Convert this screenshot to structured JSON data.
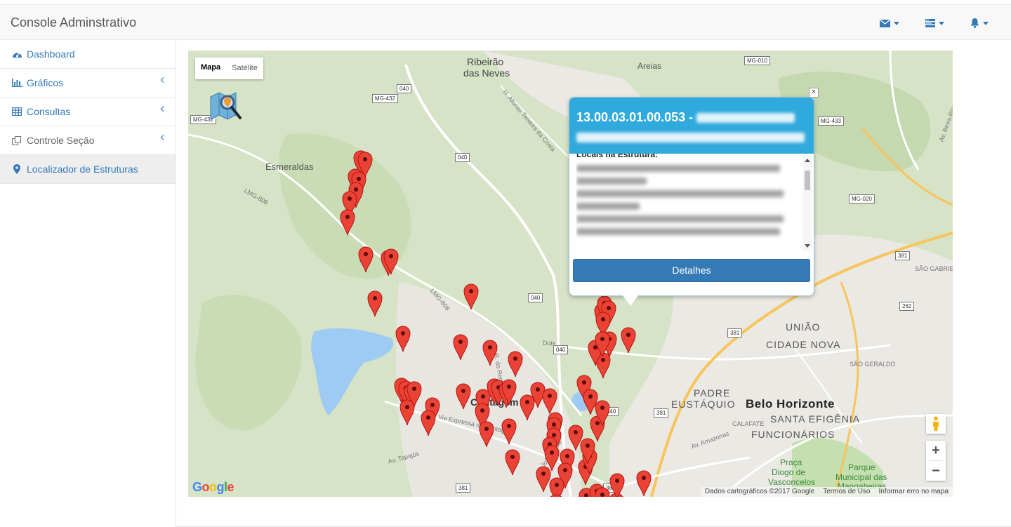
{
  "app": {
    "title": "Console Adminstrativo"
  },
  "navbar": {
    "icons": [
      "envelope-icon",
      "tasks-icon",
      "bell-icon"
    ],
    "accent": "#337ab7"
  },
  "sidebar": {
    "items": [
      {
        "label": "Dashboard",
        "icon": "dashboard-icon",
        "has_submenu": false
      },
      {
        "label": "Gráficos",
        "icon": "bar-chart-icon",
        "has_submenu": true
      },
      {
        "label": "Consultas",
        "icon": "table-icon",
        "has_submenu": true
      },
      {
        "label": "Controle Seção",
        "icon": "copy-icon",
        "has_submenu": true
      },
      {
        "label": "Localizador de Estruturas",
        "icon": "map-marker-icon",
        "has_submenu": false,
        "active": true
      }
    ]
  },
  "map": {
    "type_control": {
      "map": "Mapa",
      "satellite": "Satélite",
      "selected": "Mapa"
    },
    "labels": {
      "ribeirao": "Ribeirão",
      "das_neves": "das Neves",
      "areias": "Areias",
      "esmeraldas": "Esmeraldas",
      "contagem": "Contagem",
      "belo_horizonte": "Belo Horizonte",
      "uniao": "UNIÃO",
      "cidade_nova": "CIDADE NOVA",
      "padre": "PADRE",
      "eustaquio": "EUSTÁQUIO",
      "santa_efigenia": "SANTA EFIGÊNIA",
      "funcionarios": "FUNCIONÁRIOS",
      "calafate": "CALAFATE",
      "sao_gabriel": "SÃO GABRIEL",
      "sao_geraldo": "SÃO GERALDO",
      "praca_1": "Praça",
      "praca_2": "Diogo de",
      "praca_3": "Vasconcelos",
      "parque_1": "Parque",
      "parque_2": "Municipal das",
      "parque_3": "Mangabeiras",
      "via_expressa": "Via Expressa de Contagem",
      "av_tapajos": "Av. Tapajós",
      "av_amazonas": "Av. Amazonas",
      "av_joao_cesar": "Av. João César",
      "r_regimento": "R. do Registro",
      "r_teixeira": "R. Afonso Teixeira da Costa",
      "lmg808": "LMG-808",
      "av_beira_rio": "Av. Beira-Rio",
      "dois": "Dois"
    },
    "shields": {
      "mg432_a": "MG-432",
      "mg432_b": "MG-432",
      "r040_a": "040",
      "r040_b": "040",
      "r040_c": "040",
      "r040_d": "040",
      "r040_e": "040",
      "mg010": "MG-010",
      "mg433": "MG-433",
      "mg020": "MG-020",
      "r381_a": "381",
      "r381_b": "381",
      "r381_c": "381",
      "r381_d": "381",
      "r262": "262",
      "r381_e": "381"
    },
    "infowindow": {
      "title": "13.00.03.01.00.053 -",
      "section_label": "Locais na Estrutura:",
      "button": "Detalhes",
      "close": "×"
    },
    "zoom": {
      "in": "+",
      "out": "−"
    },
    "attribution": {
      "data": "Dados cartográficos ©2017 Google",
      "terms": "Termos de Uso",
      "report": "Informar erro no mapa"
    },
    "logo": "Google",
    "marker_color": "#ea4335"
  }
}
